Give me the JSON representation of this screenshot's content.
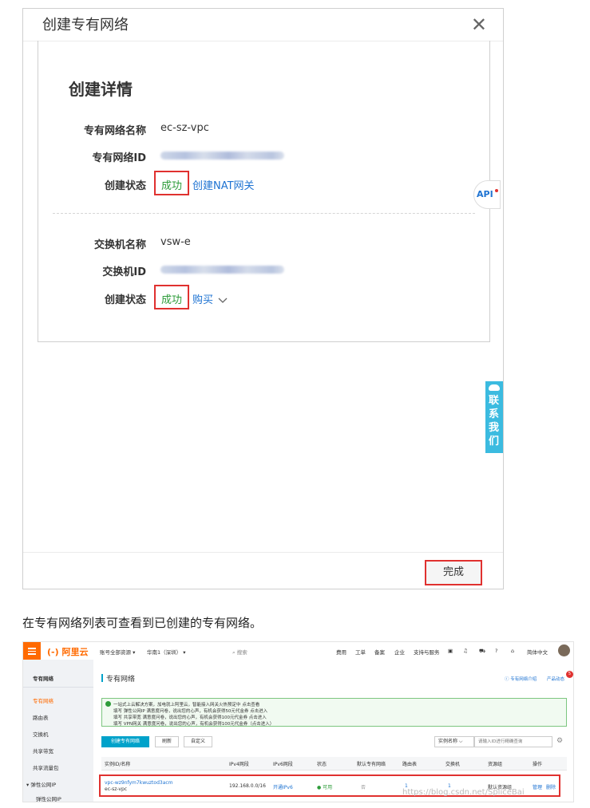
{
  "dialog": {
    "title": "创建专有网络",
    "close_glyph": "✕",
    "detail_title": "创建详情",
    "vpc": {
      "name_label": "专有网络名称",
      "name_value": "ec-sz-vpc",
      "id_label": "专有网络ID",
      "status_label": "创建状态",
      "status_value": "成功",
      "action_link": "创建NAT网关"
    },
    "vswitch": {
      "name_label": "交换机名称",
      "name_value": "vsw-e",
      "id_label": "交换机ID",
      "status_label": "创建状态",
      "status_value": "成功",
      "action_link": "购买"
    },
    "api_tab": "API",
    "contact_tab": [
      "联",
      "系",
      "我",
      "们"
    ],
    "done_button": "完成"
  },
  "caption": "在专有网络列表可查看到已创建的专有网络。",
  "console": {
    "logo": "(-) 阿里云",
    "topbar": {
      "resource": "账号全部资源 ▾",
      "region": "华南1（深圳） ▾",
      "search": "搜索",
      "links": [
        "费用",
        "工单",
        "备案",
        "企业",
        "支持与服务"
      ],
      "language": "简体中文"
    },
    "sidebar": {
      "title": "专有网络",
      "items": [
        "专有网络",
        "路由表",
        "交换机",
        "共享带宽",
        "共享流量包",
        "▾ 弹性公网IP",
        "弹性公网IP"
      ]
    },
    "page_title": "专有网络",
    "header_links": [
      "专有网络介绍",
      "产品动态"
    ],
    "notice_badge": "5",
    "notice_lines": [
      "一站式上云解决方案，加电就上阿里云，智能接入网关火热预定中 点击查看",
      "填写 弹性公网IP 满意度问卷，说出您的心声，有机会获得50元代金券 点击进入",
      "填写 共享带宽 满意度问卷，说出您的心声，有机会获得100元代金券 点击进入",
      "填写 VPN网关 满意度问卷，说出您的心声，有机会获得100元代金券（点击进入）"
    ],
    "buttons": {
      "create": "创建专有网络",
      "refresh": "刷新",
      "custom": "自定义"
    },
    "filter": "实例名称  ⌵",
    "search_placeholder": "请输入ID进行精确查询",
    "table": {
      "headers": [
        "实例ID/名称",
        "IPv4网段",
        "IPv6网段",
        "状态",
        "默认专有网络",
        "路由表",
        "交换机",
        "资源组",
        "操作"
      ],
      "row": {
        "id": "vpc-wz9nfym7kwuztod3acm",
        "name": "ec-sz-vpc",
        "ipv4": "192.168.0.0/16",
        "ipv6": "开通IPv6",
        "status": "● 可用",
        "default": "否",
        "route_tables": "1",
        "vswitches": "1",
        "resource_group": "默认资源组",
        "ops": [
          "管理",
          "删除"
        ]
      }
    }
  },
  "watermark": "https://blog.csdn.net/SpliceBai",
  "colors": {
    "accent": "#ff6a00",
    "success": "#2e9c3a",
    "link": "#1e73d2",
    "highlight": "#e0312f",
    "primary_button": "#00a2ca"
  }
}
